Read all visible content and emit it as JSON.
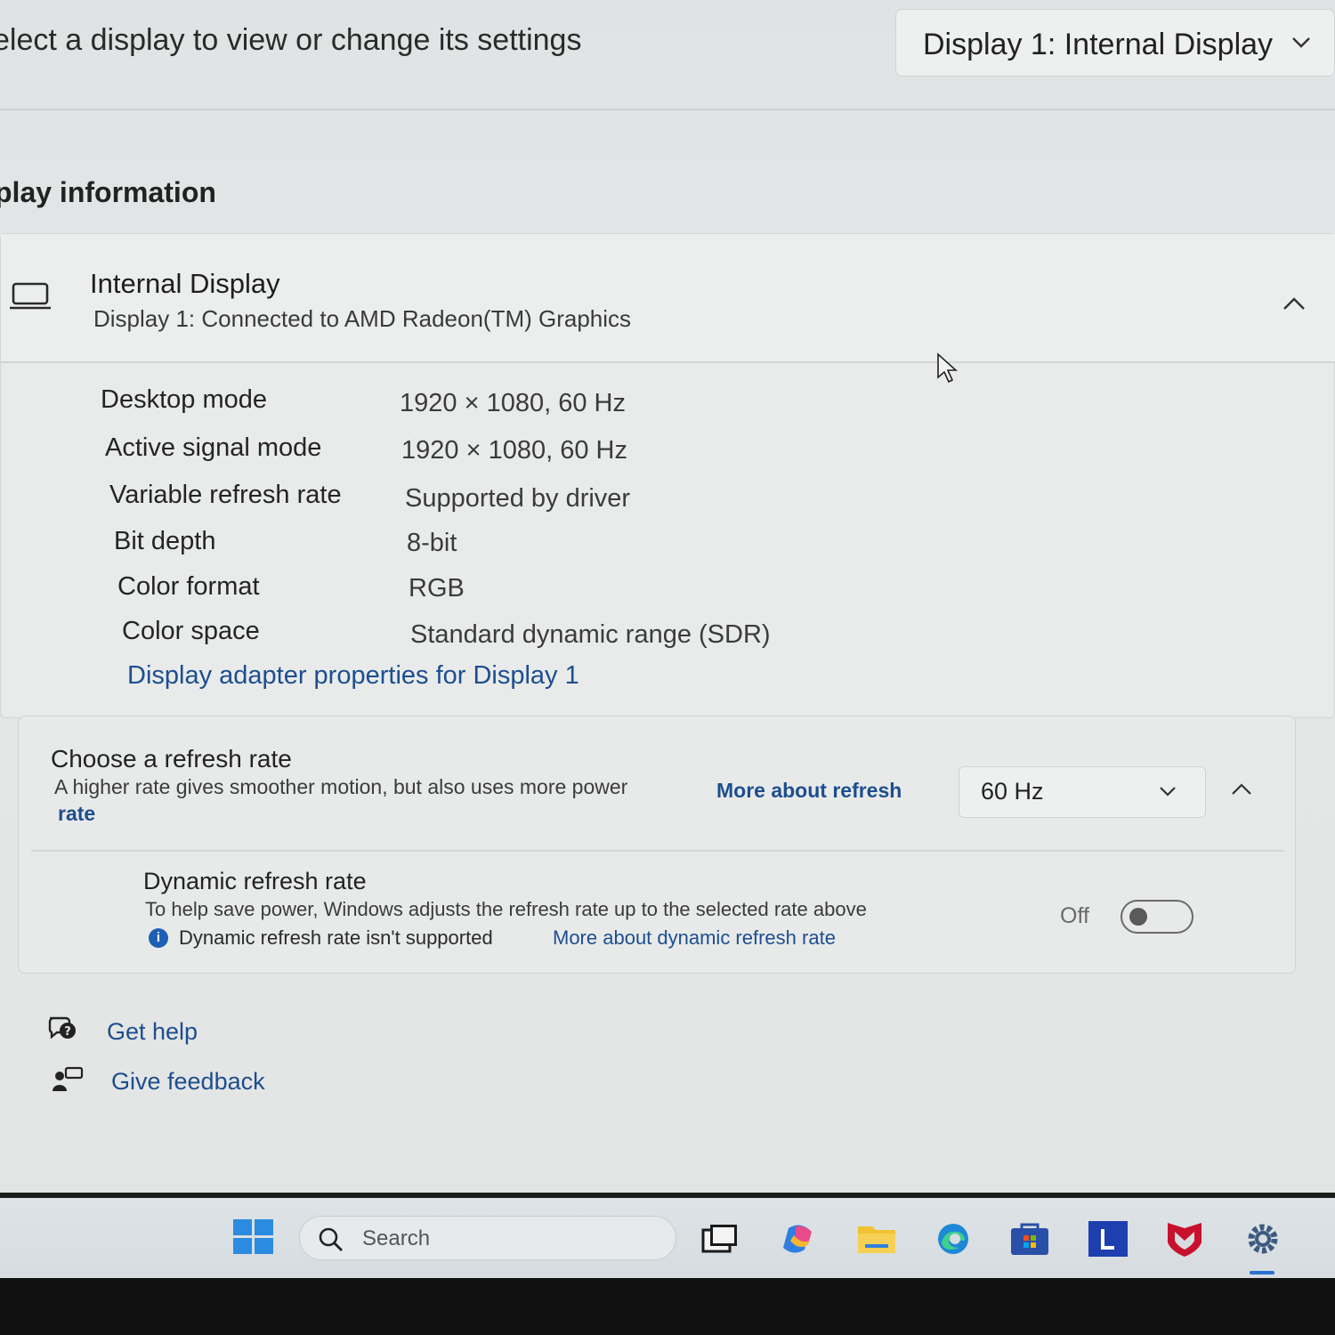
{
  "header": {
    "prompt": "elect a display to view or change its settings",
    "display_select": "Display 1: Internal Display"
  },
  "section": {
    "title": "play information"
  },
  "display_card": {
    "title": "Internal Display",
    "subtitle": "Display 1: Connected to AMD Radeon(TM) Graphics",
    "rows": [
      {
        "label": "Desktop mode",
        "value": "1920 × 1080, 60 Hz"
      },
      {
        "label": "Active signal mode",
        "value": "1920 × 1080, 60 Hz"
      },
      {
        "label": "Variable refresh rate",
        "value": "Supported by driver"
      },
      {
        "label": "Bit depth",
        "value": "8-bit"
      },
      {
        "label": "Color format",
        "value": "RGB"
      },
      {
        "label": "Color space",
        "value": "Standard dynamic range (SDR)"
      }
    ],
    "adapter_link": "Display adapter properties for Display 1"
  },
  "refresh": {
    "title": "Choose a refresh rate",
    "description": "A higher rate gives smoother motion, but also uses more power",
    "link_line1": "More about refresh",
    "link_line2": "rate",
    "selected": "60 Hz",
    "dynamic": {
      "title": "Dynamic refresh rate",
      "description": "To help save power, Windows adjusts the refresh rate up to the selected rate above",
      "note_icon": "i",
      "note": "Dynamic refresh rate isn't supported",
      "link": "More about dynamic refresh rate",
      "toggle_state": "Off"
    }
  },
  "help": {
    "get_help": "Get help",
    "give_feedback": "Give feedback"
  },
  "taskbar": {
    "search_placeholder": "Search",
    "icons": [
      "task-view-icon",
      "copilot-icon",
      "file-explorer-icon",
      "edge-icon",
      "store-icon",
      "lenovo-icon",
      "mcafee-icon",
      "settings-icon"
    ]
  },
  "colors": {
    "accent": "#1d4e8f",
    "windows_blue": "#2a8be0"
  }
}
